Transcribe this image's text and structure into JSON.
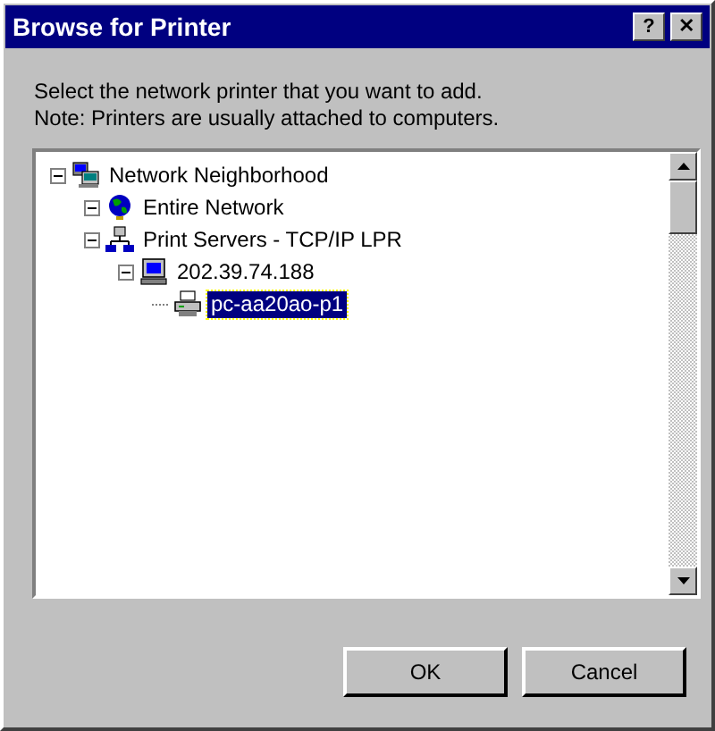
{
  "window": {
    "title": "Browse for Printer",
    "title_buttons": [
      "?",
      "✕"
    ]
  },
  "instructions": [
    "Select the network printer that you want to add.",
    "Note: Printers are usually attached to computers."
  ],
  "tree": [
    {
      "label": "Network Neighborhood",
      "kind": "network",
      "expanded": true,
      "selected": false,
      "children": [
        {
          "label": "Entire Network",
          "kind": "globe",
          "expanded": true,
          "selected": false
        },
        {
          "label": "Print Servers - TCP/IP LPR",
          "kind": "servers",
          "expanded": true,
          "selected": false,
          "children": [
            {
              "label": "202.39.74.188",
              "kind": "computer",
              "expanded": true,
              "selected": false,
              "children": [
                {
                  "label": "pc-aa20ao-p1",
                  "kind": "printer",
                  "selected": true
                }
              ]
            }
          ]
        }
      ]
    }
  ],
  "buttons": [
    "OK",
    "Cancel"
  ]
}
